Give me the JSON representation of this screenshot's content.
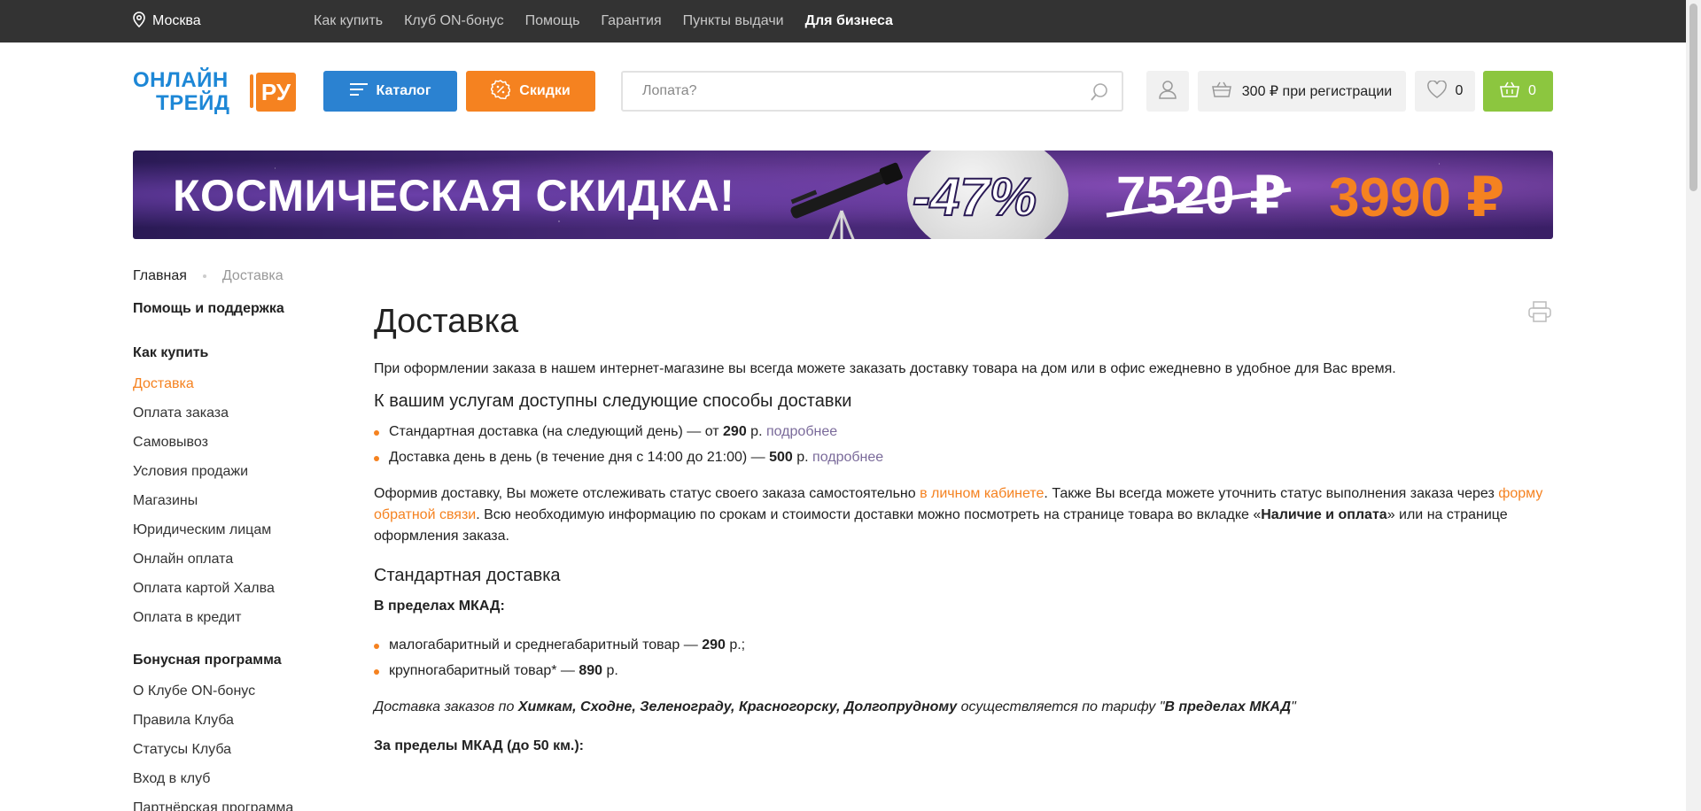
{
  "topbar": {
    "city": "Москва",
    "links": [
      "Как купить",
      "Клуб ON-бонус",
      "Помощь",
      "Гарантия",
      "Пункты выдачи"
    ],
    "business": "Для бизнеса"
  },
  "header": {
    "logo_line1": "ОНЛАЙН",
    "logo_line2": "ТРЕЙД",
    "logo_ru": "РУ",
    "catalog_label": "Каталог",
    "sale_label": "Скидки",
    "search_placeholder": "Лопата?",
    "registration_text": "300 ₽ при регистрации",
    "favorites_count": "0",
    "cart_count": "0"
  },
  "banner": {
    "headline": "КОСМИЧЕСКАЯ СКИДКА!",
    "discount": "-47%",
    "old_price": "7520 ₽",
    "new_price": "3990 ₽"
  },
  "breadcrumb": {
    "home": "Главная",
    "current": "Доставка"
  },
  "sidebar": {
    "help_title": "Помощь и поддержка",
    "how_to_buy_title": "Как купить",
    "how_to_buy_items": [
      "Доставка",
      "Оплата заказа",
      "Самовывоз",
      "Условия продажи",
      "Магазины",
      "Юридическим лицам",
      "Онлайн оплата",
      "Оплата картой Халва",
      "Оплата в кредит"
    ],
    "bonus_title": "Бонусная программа",
    "bonus_items": [
      "О Клубе ON-бонус",
      "Правила Клуба",
      "Статусы Клуба",
      "Вход в клуб",
      "Партнёрская программа"
    ]
  },
  "content": {
    "title": "Доставка",
    "intro": "При оформлении заказа в нашем интернет-магазине вы всегда можете заказать доставку товара на дом или в офис ежедневно в удобное для Вас время.",
    "methods_heading": "К вашим услугам доступны следующие способы доставки",
    "method1_text": "Стандартная доставка (на следующий день) — от ",
    "method1_price": "290",
    "method1_suffix": " р. ",
    "method2_text": "Доставка день в день (в течение дня с 14:00 до 21:00) — ",
    "method2_price": "500",
    "method2_suffix": " р. ",
    "more_link": "подробнее",
    "tracking_part1": "Оформив доставку, Вы можете отслеживать статус своего заказа самостоятельно ",
    "tracking_link1": "в личном кабинете",
    "tracking_part2": ". Также Вы всегда можете уточнить статус выполнения заказа через ",
    "tracking_link2": "форму обратной связи",
    "tracking_part3": ". Всю необходимую информацию по срокам и стоимости доставки можно посмотреть на странице товара во вкладке «",
    "tracking_bold": "Наличие и оплата",
    "tracking_part4": "» или на странице оформления заказа.",
    "standard_heading": "Стандартная доставка",
    "mkad_label": "В пределах МКАД:",
    "mkad_item1_text": "малогабаритный и среднегабаритный товар — ",
    "mkad_item1_price": "290",
    "mkad_item1_suffix": " р.;",
    "mkad_item2_text": "крупногабаритный товар* — ",
    "mkad_item2_price": "890",
    "mkad_item2_suffix": " р.",
    "cities_prefix": "Доставка заказов по ",
    "cities_bold": "Химкам, Сходне, Зеленограду, Красногорску, Долгопрудному",
    "cities_mid": " осуществляется по тарифу \"",
    "cities_tariff": "В пределах МКАД",
    "cities_end": "\"",
    "outside_label": "За пределы МКАД (до 50 км.):"
  },
  "colors": {
    "accent_orange": "#f58220",
    "brand_blue": "#2b82d1",
    "cart_green": "#8cc63f",
    "topbar": "#333333"
  }
}
